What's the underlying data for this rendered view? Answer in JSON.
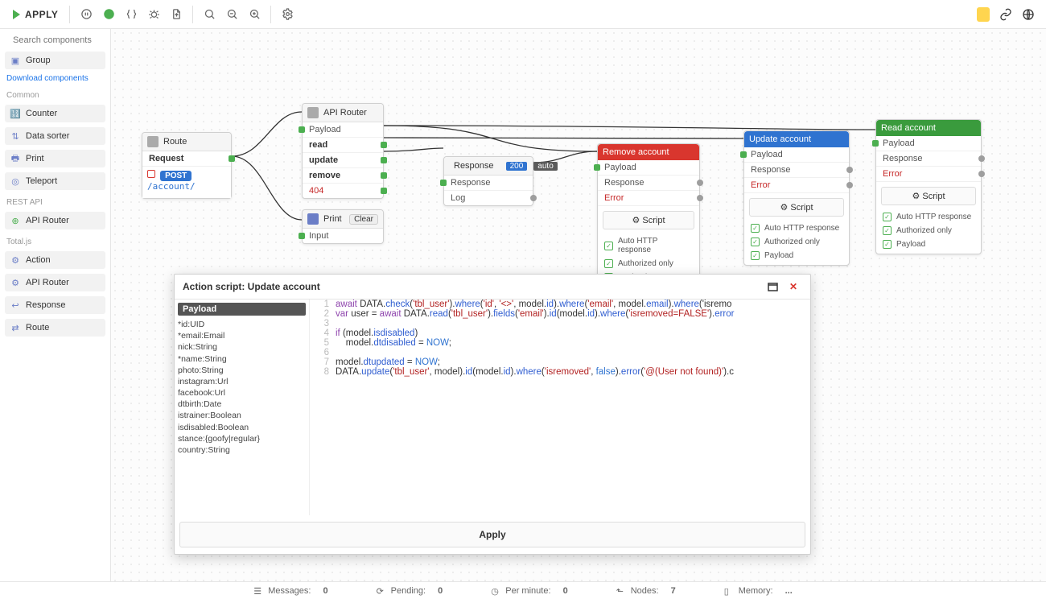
{
  "toolbar": {
    "apply": "APPLY",
    "icons": [
      "pause",
      "add",
      "braces",
      "bug",
      "export",
      "zoom-fit",
      "zoom-out",
      "zoom-in",
      "settings"
    ],
    "right_icons": [
      "notes",
      "link",
      "globe"
    ]
  },
  "sidebar": {
    "search_placeholder": "Search components",
    "group_label": "Group",
    "download_label": "Download components",
    "sections": [
      {
        "title": "Common",
        "items": [
          "Counter",
          "Data sorter",
          "Print",
          "Teleport"
        ]
      },
      {
        "title": "REST API",
        "items": [
          "API Router"
        ]
      },
      {
        "title": "Total.js",
        "items": [
          "Action",
          "API Router",
          "Response",
          "Route"
        ]
      }
    ]
  },
  "nodes": {
    "route": {
      "title": "Route",
      "request_label": "Request",
      "method": "POST",
      "path": "/account/"
    },
    "api": {
      "title": "API Router",
      "rows": [
        "Payload",
        "read",
        "update",
        "remove",
        "404"
      ]
    },
    "print": {
      "title": "Print",
      "clear": "Clear",
      "input": "Input"
    },
    "response": {
      "title": "Response",
      "code": "200",
      "auto": "auto",
      "rows": [
        "Response",
        "Log"
      ]
    },
    "remove": {
      "title": "Remove account",
      "rows": [
        "Payload",
        "Response",
        "Error"
      ],
      "script": "Script",
      "checks": [
        "Auto HTTP response",
        "Authorized only",
        "Payload"
      ]
    },
    "update": {
      "title": "Update account",
      "rows": [
        "Payload",
        "Response",
        "Error"
      ],
      "script": "Script",
      "checks": [
        "Auto HTTP response",
        "Authorized only",
        "Payload"
      ]
    },
    "read": {
      "title": "Read account",
      "rows": [
        "Payload",
        "Response",
        "Error"
      ],
      "script": "Script",
      "checks": [
        "Auto HTTP response",
        "Authorized only",
        "Payload"
      ]
    }
  },
  "panel": {
    "title": "Action script: Update account",
    "payload_header": "Payload",
    "payload_schema": "*id:UID\n*email:Email\nnick:String\n*name:String\nphoto:String\ninstagram:Url\nfacebook:Url\ndtbirth:Date\nistrainer:Boolean\nisdisabled:Boolean\nstance:{goofy|regular}\ncountry:String",
    "apply": "Apply",
    "code": [
      "await DATA.check('tbl_user').where('id', '<>', model.id).where('email', model.email).where('isremo",
      "var user = await DATA.read('tbl_user').fields('email').id(model.id).where('isremoved=FALSE').error",
      "",
      "if (model.isdisabled)",
      "    model.dtdisabled = NOW;",
      "",
      "model.dtupdated = NOW;",
      "DATA.update('tbl_user', model).id(model.id).where('isremoved', false).error('@(User not found)').c"
    ]
  },
  "status": {
    "messages": {
      "label": "Messages:",
      "value": "0"
    },
    "pending": {
      "label": "Pending:",
      "value": "0"
    },
    "perminute": {
      "label": "Per minute:",
      "value": "0"
    },
    "nodes": {
      "label": "Nodes:",
      "value": "7"
    },
    "memory": {
      "label": "Memory:",
      "value": "..."
    }
  }
}
